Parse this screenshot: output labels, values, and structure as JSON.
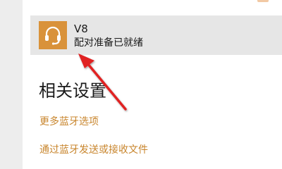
{
  "device": {
    "name": "V8",
    "status": "配对准备已就绪",
    "icon": "headset-icon",
    "icon_bg_color": "#d9923a"
  },
  "related_settings": {
    "title": "相关设置",
    "links": [
      {
        "label": "更多蓝牙选项"
      },
      {
        "label": "通过蓝牙发送或接收文件"
      }
    ],
    "link_color": "#c8852c"
  },
  "annotation": {
    "arrow_color": "#e02020"
  }
}
